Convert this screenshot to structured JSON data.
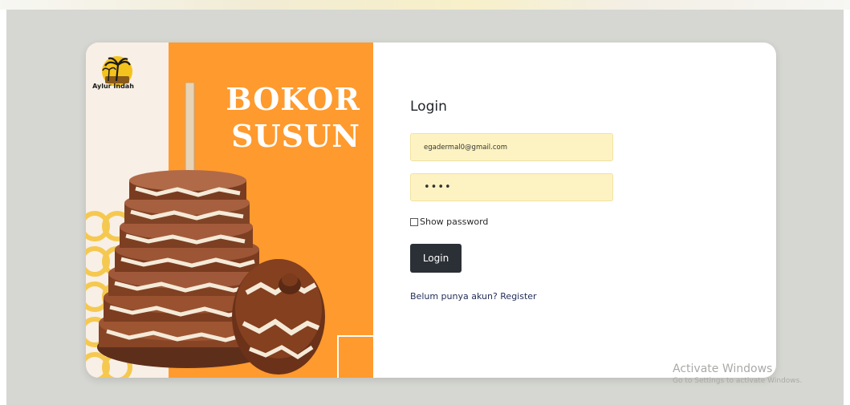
{
  "brand": {
    "logo_text": "Aylur Indah",
    "hero_title_line1": "BOKOR",
    "hero_title_line2": "SUSUN"
  },
  "login": {
    "title": "Login",
    "email_value": "egadermal0@gmail.com",
    "password_value": "••••",
    "show_password_label": "Show password",
    "show_password_checked": false,
    "submit_label": "Login",
    "register_link": "Belum punya akun? Register"
  },
  "watermark": {
    "line1": "Activate Windows",
    "line2": "Go to Settings to activate Windows."
  },
  "colors": {
    "accent_orange": "#ff9a2e",
    "input_bg": "#fdf3c2",
    "button_bg": "#2b3036",
    "backdrop": "#d6d7d2"
  },
  "icons": [
    "palm-logo-icon",
    "checkbox-icon"
  ]
}
